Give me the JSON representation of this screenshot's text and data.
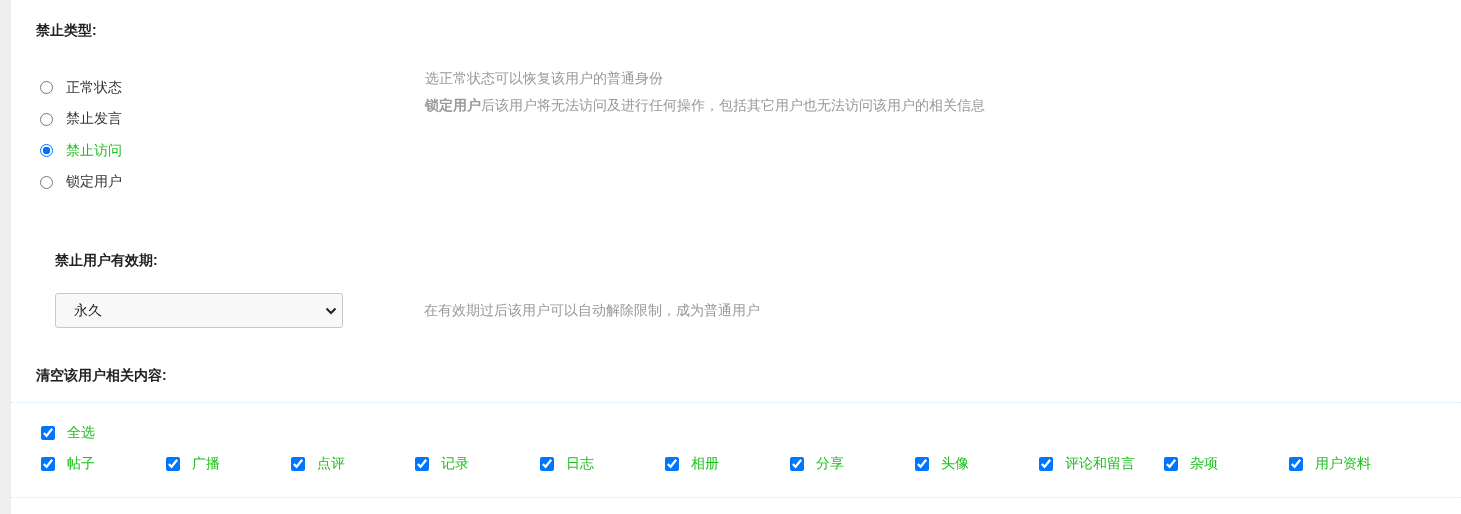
{
  "ban_type": {
    "heading": "禁止类型:",
    "options": [
      {
        "label": "正常状态",
        "selected": false
      },
      {
        "label": "禁止发言",
        "selected": false
      },
      {
        "label": "禁止访问",
        "selected": true
      },
      {
        "label": "锁定用户",
        "selected": false
      }
    ],
    "hints": [
      "选正常状态可以恢复该用户的普通身份",
      "**锁定用户**后该用户将无法访问及进行任何操作，包括其它用户也无法访问该用户的相关信息"
    ]
  },
  "validity": {
    "heading": "禁止用户有效期:",
    "value": "永久",
    "hint": "在有效期过后该用户可以自动解除限制，成为普通用户"
  },
  "clear_content": {
    "heading": "清空该用户相关内容:",
    "select_all": {
      "label": "全选",
      "checked": true
    },
    "items": [
      {
        "label": "帖子",
        "checked": true
      },
      {
        "label": "广播",
        "checked": true
      },
      {
        "label": "点评",
        "checked": true
      },
      {
        "label": "记录",
        "checked": true
      },
      {
        "label": "日志",
        "checked": true
      },
      {
        "label": "相册",
        "checked": true
      },
      {
        "label": "分享",
        "checked": true
      },
      {
        "label": "头像",
        "checked": true
      },
      {
        "label": "评论和留言",
        "checked": true
      },
      {
        "label": "杂项",
        "checked": true
      },
      {
        "label": "用户资料",
        "checked": true
      }
    ]
  }
}
